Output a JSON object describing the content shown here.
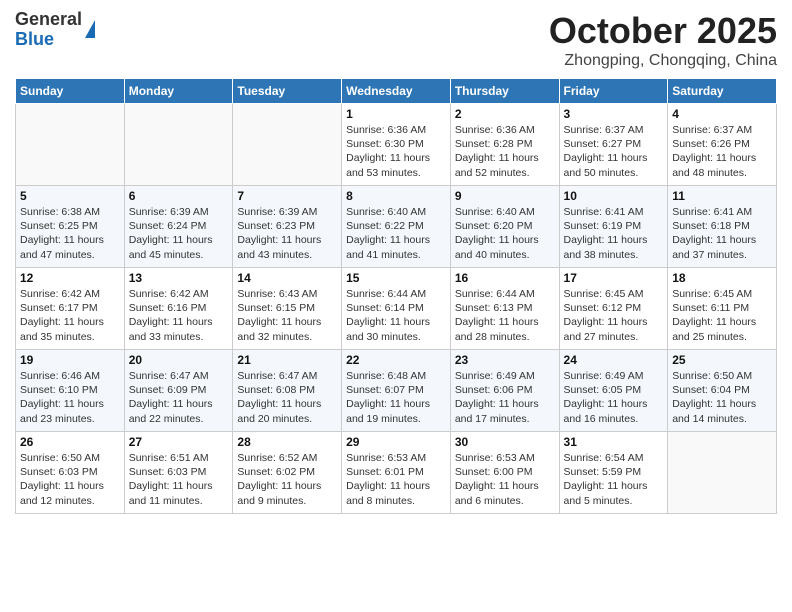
{
  "logo": {
    "general": "General",
    "blue": "Blue"
  },
  "header": {
    "month": "October 2025",
    "location": "Zhongping, Chongqing, China"
  },
  "days_of_week": [
    "Sunday",
    "Monday",
    "Tuesday",
    "Wednesday",
    "Thursday",
    "Friday",
    "Saturday"
  ],
  "weeks": [
    [
      {
        "day": "",
        "info": ""
      },
      {
        "day": "",
        "info": ""
      },
      {
        "day": "",
        "info": ""
      },
      {
        "day": "1",
        "info": "Sunrise: 6:36 AM\nSunset: 6:30 PM\nDaylight: 11 hours and 53 minutes."
      },
      {
        "day": "2",
        "info": "Sunrise: 6:36 AM\nSunset: 6:28 PM\nDaylight: 11 hours and 52 minutes."
      },
      {
        "day": "3",
        "info": "Sunrise: 6:37 AM\nSunset: 6:27 PM\nDaylight: 11 hours and 50 minutes."
      },
      {
        "day": "4",
        "info": "Sunrise: 6:37 AM\nSunset: 6:26 PM\nDaylight: 11 hours and 48 minutes."
      }
    ],
    [
      {
        "day": "5",
        "info": "Sunrise: 6:38 AM\nSunset: 6:25 PM\nDaylight: 11 hours and 47 minutes."
      },
      {
        "day": "6",
        "info": "Sunrise: 6:39 AM\nSunset: 6:24 PM\nDaylight: 11 hours and 45 minutes."
      },
      {
        "day": "7",
        "info": "Sunrise: 6:39 AM\nSunset: 6:23 PM\nDaylight: 11 hours and 43 minutes."
      },
      {
        "day": "8",
        "info": "Sunrise: 6:40 AM\nSunset: 6:22 PM\nDaylight: 11 hours and 41 minutes."
      },
      {
        "day": "9",
        "info": "Sunrise: 6:40 AM\nSunset: 6:20 PM\nDaylight: 11 hours and 40 minutes."
      },
      {
        "day": "10",
        "info": "Sunrise: 6:41 AM\nSunset: 6:19 PM\nDaylight: 11 hours and 38 minutes."
      },
      {
        "day": "11",
        "info": "Sunrise: 6:41 AM\nSunset: 6:18 PM\nDaylight: 11 hours and 37 minutes."
      }
    ],
    [
      {
        "day": "12",
        "info": "Sunrise: 6:42 AM\nSunset: 6:17 PM\nDaylight: 11 hours and 35 minutes."
      },
      {
        "day": "13",
        "info": "Sunrise: 6:42 AM\nSunset: 6:16 PM\nDaylight: 11 hours and 33 minutes."
      },
      {
        "day": "14",
        "info": "Sunrise: 6:43 AM\nSunset: 6:15 PM\nDaylight: 11 hours and 32 minutes."
      },
      {
        "day": "15",
        "info": "Sunrise: 6:44 AM\nSunset: 6:14 PM\nDaylight: 11 hours and 30 minutes."
      },
      {
        "day": "16",
        "info": "Sunrise: 6:44 AM\nSunset: 6:13 PM\nDaylight: 11 hours and 28 minutes."
      },
      {
        "day": "17",
        "info": "Sunrise: 6:45 AM\nSunset: 6:12 PM\nDaylight: 11 hours and 27 minutes."
      },
      {
        "day": "18",
        "info": "Sunrise: 6:45 AM\nSunset: 6:11 PM\nDaylight: 11 hours and 25 minutes."
      }
    ],
    [
      {
        "day": "19",
        "info": "Sunrise: 6:46 AM\nSunset: 6:10 PM\nDaylight: 11 hours and 23 minutes."
      },
      {
        "day": "20",
        "info": "Sunrise: 6:47 AM\nSunset: 6:09 PM\nDaylight: 11 hours and 22 minutes."
      },
      {
        "day": "21",
        "info": "Sunrise: 6:47 AM\nSunset: 6:08 PM\nDaylight: 11 hours and 20 minutes."
      },
      {
        "day": "22",
        "info": "Sunrise: 6:48 AM\nSunset: 6:07 PM\nDaylight: 11 hours and 19 minutes."
      },
      {
        "day": "23",
        "info": "Sunrise: 6:49 AM\nSunset: 6:06 PM\nDaylight: 11 hours and 17 minutes."
      },
      {
        "day": "24",
        "info": "Sunrise: 6:49 AM\nSunset: 6:05 PM\nDaylight: 11 hours and 16 minutes."
      },
      {
        "day": "25",
        "info": "Sunrise: 6:50 AM\nSunset: 6:04 PM\nDaylight: 11 hours and 14 minutes."
      }
    ],
    [
      {
        "day": "26",
        "info": "Sunrise: 6:50 AM\nSunset: 6:03 PM\nDaylight: 11 hours and 12 minutes."
      },
      {
        "day": "27",
        "info": "Sunrise: 6:51 AM\nSunset: 6:03 PM\nDaylight: 11 hours and 11 minutes."
      },
      {
        "day": "28",
        "info": "Sunrise: 6:52 AM\nSunset: 6:02 PM\nDaylight: 11 hours and 9 minutes."
      },
      {
        "day": "29",
        "info": "Sunrise: 6:53 AM\nSunset: 6:01 PM\nDaylight: 11 hours and 8 minutes."
      },
      {
        "day": "30",
        "info": "Sunrise: 6:53 AM\nSunset: 6:00 PM\nDaylight: 11 hours and 6 minutes."
      },
      {
        "day": "31",
        "info": "Sunrise: 6:54 AM\nSunset: 5:59 PM\nDaylight: 11 hours and 5 minutes."
      },
      {
        "day": "",
        "info": ""
      }
    ]
  ]
}
